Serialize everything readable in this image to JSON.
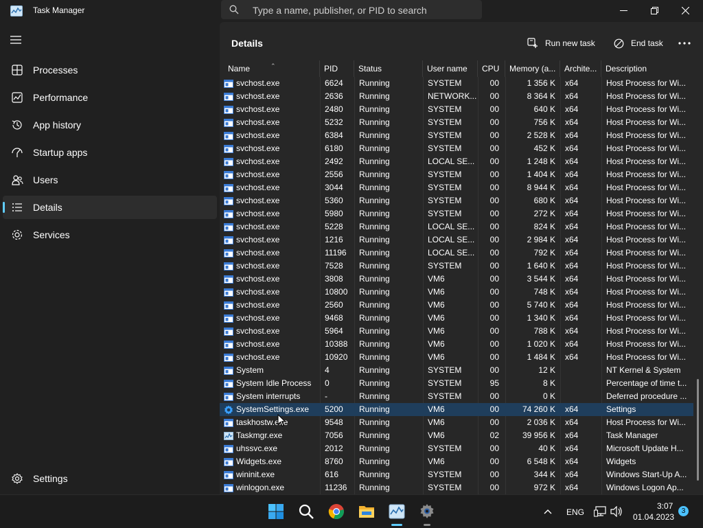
{
  "app": {
    "title": "Task Manager"
  },
  "search": {
    "placeholder": "Type a name, publisher, or PID to search"
  },
  "sidebar": {
    "items": [
      {
        "label": "Processes",
        "icon": "processes-icon"
      },
      {
        "label": "Performance",
        "icon": "performance-icon"
      },
      {
        "label": "App history",
        "icon": "app-history-icon"
      },
      {
        "label": "Startup apps",
        "icon": "startup-apps-icon"
      },
      {
        "label": "Users",
        "icon": "users-icon"
      },
      {
        "label": "Details",
        "icon": "details-icon",
        "active": true
      },
      {
        "label": "Services",
        "icon": "services-icon"
      }
    ],
    "settings_label": "Settings"
  },
  "page": {
    "title": "Details"
  },
  "toolbar": {
    "run_new_task": "Run new task",
    "end_task": "End task"
  },
  "columns": {
    "name": "Name",
    "pid": "PID",
    "status": "Status",
    "user": "User name",
    "cpu": "CPU",
    "memory": "Memory (a...",
    "arch": "Archite...",
    "desc": "Description"
  },
  "rows": [
    {
      "name": "svchost.exe",
      "pid": "6624",
      "status": "Running",
      "user": "SYSTEM",
      "cpu": "00",
      "mem": "1 356 K",
      "arch": "x64",
      "desc": "Host Process for Wi..."
    },
    {
      "name": "svchost.exe",
      "pid": "2636",
      "status": "Running",
      "user": "NETWORK...",
      "cpu": "00",
      "mem": "8 364 K",
      "arch": "x64",
      "desc": "Host Process for Wi..."
    },
    {
      "name": "svchost.exe",
      "pid": "2480",
      "status": "Running",
      "user": "SYSTEM",
      "cpu": "00",
      "mem": "640 K",
      "arch": "x64",
      "desc": "Host Process for Wi..."
    },
    {
      "name": "svchost.exe",
      "pid": "5232",
      "status": "Running",
      "user": "SYSTEM",
      "cpu": "00",
      "mem": "756 K",
      "arch": "x64",
      "desc": "Host Process for Wi..."
    },
    {
      "name": "svchost.exe",
      "pid": "6384",
      "status": "Running",
      "user": "SYSTEM",
      "cpu": "00",
      "mem": "2 528 K",
      "arch": "x64",
      "desc": "Host Process for Wi..."
    },
    {
      "name": "svchost.exe",
      "pid": "6180",
      "status": "Running",
      "user": "SYSTEM",
      "cpu": "00",
      "mem": "452 K",
      "arch": "x64",
      "desc": "Host Process for Wi..."
    },
    {
      "name": "svchost.exe",
      "pid": "2492",
      "status": "Running",
      "user": "LOCAL SE...",
      "cpu": "00",
      "mem": "1 248 K",
      "arch": "x64",
      "desc": "Host Process for Wi..."
    },
    {
      "name": "svchost.exe",
      "pid": "2556",
      "status": "Running",
      "user": "SYSTEM",
      "cpu": "00",
      "mem": "1 404 K",
      "arch": "x64",
      "desc": "Host Process for Wi..."
    },
    {
      "name": "svchost.exe",
      "pid": "3044",
      "status": "Running",
      "user": "SYSTEM",
      "cpu": "00",
      "mem": "8 944 K",
      "arch": "x64",
      "desc": "Host Process for Wi..."
    },
    {
      "name": "svchost.exe",
      "pid": "5360",
      "status": "Running",
      "user": "SYSTEM",
      "cpu": "00",
      "mem": "680 K",
      "arch": "x64",
      "desc": "Host Process for Wi..."
    },
    {
      "name": "svchost.exe",
      "pid": "5980",
      "status": "Running",
      "user": "SYSTEM",
      "cpu": "00",
      "mem": "272 K",
      "arch": "x64",
      "desc": "Host Process for Wi..."
    },
    {
      "name": "svchost.exe",
      "pid": "5228",
      "status": "Running",
      "user": "LOCAL SE...",
      "cpu": "00",
      "mem": "824 K",
      "arch": "x64",
      "desc": "Host Process for Wi..."
    },
    {
      "name": "svchost.exe",
      "pid": "1216",
      "status": "Running",
      "user": "LOCAL SE...",
      "cpu": "00",
      "mem": "2 984 K",
      "arch": "x64",
      "desc": "Host Process for Wi..."
    },
    {
      "name": "svchost.exe",
      "pid": "11196",
      "status": "Running",
      "user": "LOCAL SE...",
      "cpu": "00",
      "mem": "792 K",
      "arch": "x64",
      "desc": "Host Process for Wi..."
    },
    {
      "name": "svchost.exe",
      "pid": "7528",
      "status": "Running",
      "user": "SYSTEM",
      "cpu": "00",
      "mem": "1 640 K",
      "arch": "x64",
      "desc": "Host Process for Wi..."
    },
    {
      "name": "svchost.exe",
      "pid": "3808",
      "status": "Running",
      "user": "VM6",
      "cpu": "00",
      "mem": "3 544 K",
      "arch": "x64",
      "desc": "Host Process for Wi..."
    },
    {
      "name": "svchost.exe",
      "pid": "10800",
      "status": "Running",
      "user": "VM6",
      "cpu": "00",
      "mem": "748 K",
      "arch": "x64",
      "desc": "Host Process for Wi..."
    },
    {
      "name": "svchost.exe",
      "pid": "2560",
      "status": "Running",
      "user": "VM6",
      "cpu": "00",
      "mem": "5 740 K",
      "arch": "x64",
      "desc": "Host Process for Wi..."
    },
    {
      "name": "svchost.exe",
      "pid": "9468",
      "status": "Running",
      "user": "VM6",
      "cpu": "00",
      "mem": "1 340 K",
      "arch": "x64",
      "desc": "Host Process for Wi..."
    },
    {
      "name": "svchost.exe",
      "pid": "5964",
      "status": "Running",
      "user": "VM6",
      "cpu": "00",
      "mem": "788 K",
      "arch": "x64",
      "desc": "Host Process for Wi..."
    },
    {
      "name": "svchost.exe",
      "pid": "10388",
      "status": "Running",
      "user": "VM6",
      "cpu": "00",
      "mem": "1 020 K",
      "arch": "x64",
      "desc": "Host Process for Wi..."
    },
    {
      "name": "svchost.exe",
      "pid": "10920",
      "status": "Running",
      "user": "VM6",
      "cpu": "00",
      "mem": "1 484 K",
      "arch": "x64",
      "desc": "Host Process for Wi..."
    },
    {
      "name": "System",
      "pid": "4",
      "status": "Running",
      "user": "SYSTEM",
      "cpu": "00",
      "mem": "12 K",
      "arch": "",
      "desc": "NT Kernel & System"
    },
    {
      "name": "System Idle Process",
      "pid": "0",
      "status": "Running",
      "user": "SYSTEM",
      "cpu": "95",
      "mem": "8 K",
      "arch": "",
      "desc": "Percentage of time t..."
    },
    {
      "name": "System interrupts",
      "pid": "-",
      "status": "Running",
      "user": "SYSTEM",
      "cpu": "00",
      "mem": "0 K",
      "arch": "",
      "desc": "Deferred procedure ..."
    },
    {
      "name": "SystemSettings.exe",
      "pid": "5200",
      "status": "Running",
      "user": "VM6",
      "cpu": "00",
      "mem": "74 260 K",
      "arch": "x64",
      "desc": "Settings",
      "icon": "gear",
      "selected": true
    },
    {
      "name": "taskhostw.exe",
      "pid": "9548",
      "status": "Running",
      "user": "VM6",
      "cpu": "00",
      "mem": "2 036 K",
      "arch": "x64",
      "desc": "Host Process for Wi..."
    },
    {
      "name": "Taskmgr.exe",
      "pid": "7056",
      "status": "Running",
      "user": "VM6",
      "cpu": "02",
      "mem": "39 956 K",
      "arch": "x64",
      "desc": "Task Manager",
      "icon": "taskmgr"
    },
    {
      "name": "uhssvc.exe",
      "pid": "2012",
      "status": "Running",
      "user": "SYSTEM",
      "cpu": "00",
      "mem": "40 K",
      "arch": "x64",
      "desc": "Microsoft Update H..."
    },
    {
      "name": "Widgets.exe",
      "pid": "8760",
      "status": "Running",
      "user": "VM6",
      "cpu": "00",
      "mem": "6 548 K",
      "arch": "x64",
      "desc": "Widgets"
    },
    {
      "name": "wininit.exe",
      "pid": "616",
      "status": "Running",
      "user": "SYSTEM",
      "cpu": "00",
      "mem": "344 K",
      "arch": "x64",
      "desc": "Windows Start-Up A..."
    },
    {
      "name": "winlogon.exe",
      "pid": "11236",
      "status": "Running",
      "user": "SYSTEM",
      "cpu": "00",
      "mem": "972 K",
      "arch": "x64",
      "desc": "Windows Logon Ap..."
    }
  ],
  "taskbar": {
    "icons": [
      "start-icon",
      "search-icon",
      "chrome-icon",
      "file-explorer-icon",
      "task-manager-icon",
      "settings-icon"
    ],
    "language": "ENG",
    "time": "3:07",
    "date": "01.04.2023",
    "notifications": "3"
  },
  "colors": {
    "background": "#202020",
    "panel": "#272727",
    "accent": "#60cdff",
    "selected_row": "#1f3e5c"
  }
}
